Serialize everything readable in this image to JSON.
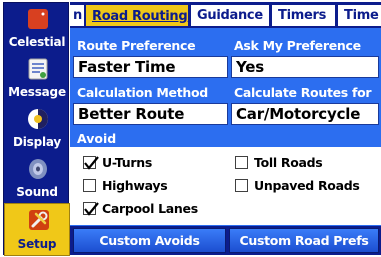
{
  "sidebar": {
    "items": [
      {
        "label": "Celestial",
        "icon": "celestial-icon"
      },
      {
        "label": "Message",
        "icon": "message-icon"
      },
      {
        "label": "Display",
        "icon": "display-icon"
      },
      {
        "label": "Sound",
        "icon": "sound-icon"
      },
      {
        "label": "Setup",
        "icon": "setup-icon",
        "active": true
      }
    ]
  },
  "tabs": [
    {
      "label": "n"
    },
    {
      "label": "Road Routing",
      "active": true
    },
    {
      "label": "Guidance"
    },
    {
      "label": "Timers"
    },
    {
      "label": "Time"
    }
  ],
  "route": {
    "route_preference_label": "Route Preference",
    "route_preference_value": "Faster Time",
    "ask_preference_label": "Ask My Preference",
    "ask_preference_value": "Yes",
    "calculation_method_label": "Calculation Method",
    "calculation_method_value": "Better Route",
    "calculate_for_label": "Calculate Routes for",
    "calculate_for_value": "Car/Motorcycle"
  },
  "avoid": {
    "header": "Avoid",
    "options": [
      {
        "label": "U-Turns",
        "checked": true
      },
      {
        "label": "Toll Roads",
        "checked": false
      },
      {
        "label": "Highways",
        "checked": false
      },
      {
        "label": "Unpaved Roads",
        "checked": false
      },
      {
        "label": "Carpool Lanes",
        "checked": true
      }
    ]
  },
  "buttons": {
    "custom_avoids": "Custom Avoids",
    "custom_road_prefs": "Custom Road Prefs"
  },
  "colors": {
    "panel_blue": "#2c6ef0",
    "dark_blue": "#0c1c8c",
    "active_yellow": "#f0c818"
  }
}
